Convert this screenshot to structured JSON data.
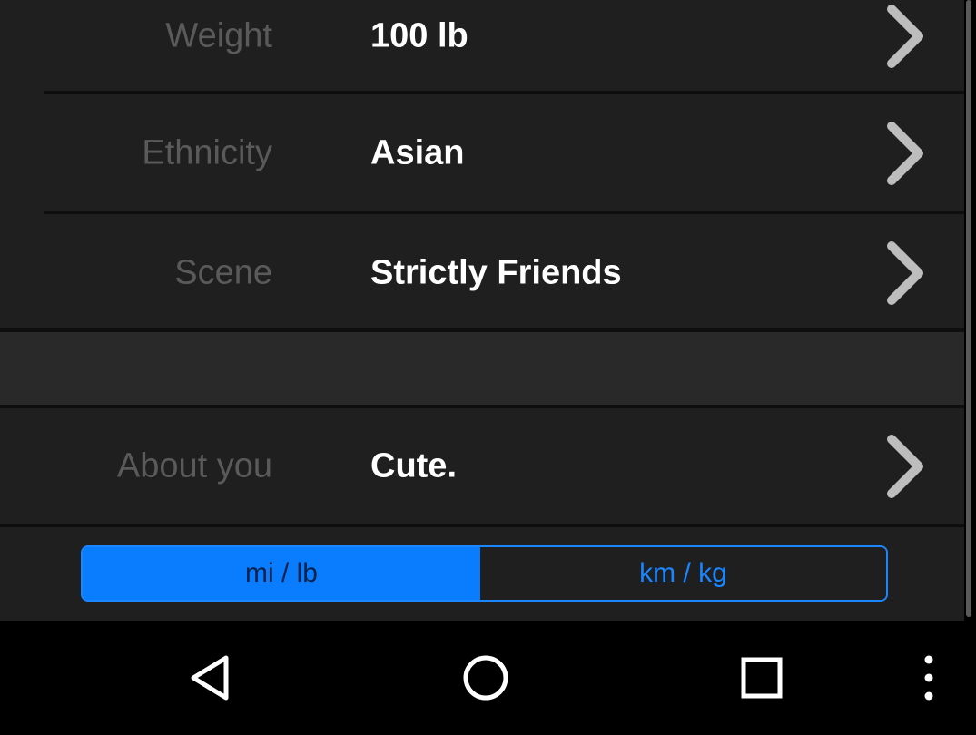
{
  "profile_rows": [
    {
      "label": "Weight",
      "value": "100 lb"
    },
    {
      "label": "Ethnicity",
      "value": "Asian"
    },
    {
      "label": "Scene",
      "value": "Strictly Friends"
    },
    {
      "label": "About you",
      "value": "Cute."
    }
  ],
  "units_toggle": {
    "imperial_label": "mi / lb",
    "metric_label": "km / kg",
    "selected": "mi / lb"
  },
  "colors": {
    "accent": "#0a7dff",
    "background": "#1f1f1f",
    "label": "#5a5a5a",
    "value": "#ffffff"
  },
  "nav_icons": [
    "back-icon",
    "home-icon",
    "recents-icon",
    "overflow-menu-icon"
  ]
}
